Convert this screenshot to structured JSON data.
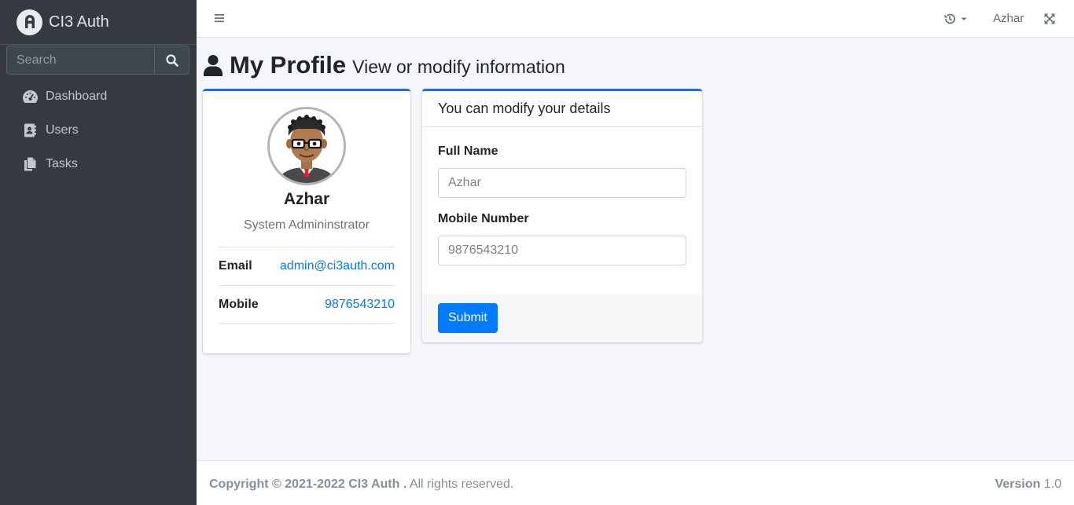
{
  "brand": {
    "name": "CI3 Auth",
    "logo_icon": "brand-logo-icon"
  },
  "search": {
    "placeholder": "Search"
  },
  "sidebar": {
    "items": [
      {
        "label": "Dashboard",
        "icon": "tachometer-icon"
      },
      {
        "label": "Users",
        "icon": "address-book-icon"
      },
      {
        "label": "Tasks",
        "icon": "copy-icon"
      }
    ]
  },
  "topbar": {
    "user_name": "Azhar"
  },
  "page": {
    "title": "My Profile",
    "subtitle": "View or modify information"
  },
  "profile": {
    "name": "Azhar",
    "role": "System Admininstrator",
    "email_label": "Email",
    "email_value": "admin@ci3auth.com",
    "mobile_label": "Mobile",
    "mobile_value": "9876543210"
  },
  "form": {
    "header": "You can modify your details",
    "full_name_label": "Full Name",
    "full_name_placeholder": "Azhar",
    "mobile_label": "Mobile Number",
    "mobile_placeholder": "9876543210",
    "submit_label": "Submit"
  },
  "footer": {
    "copyright_bold": "Copyright © 2021-2022 CI3 Auth .",
    "rights": " All rights reserved.",
    "version_label": "Version",
    "version_value": "1.0"
  },
  "colors": {
    "accent": "#007bff",
    "sidebar_bg": "#343a40"
  }
}
